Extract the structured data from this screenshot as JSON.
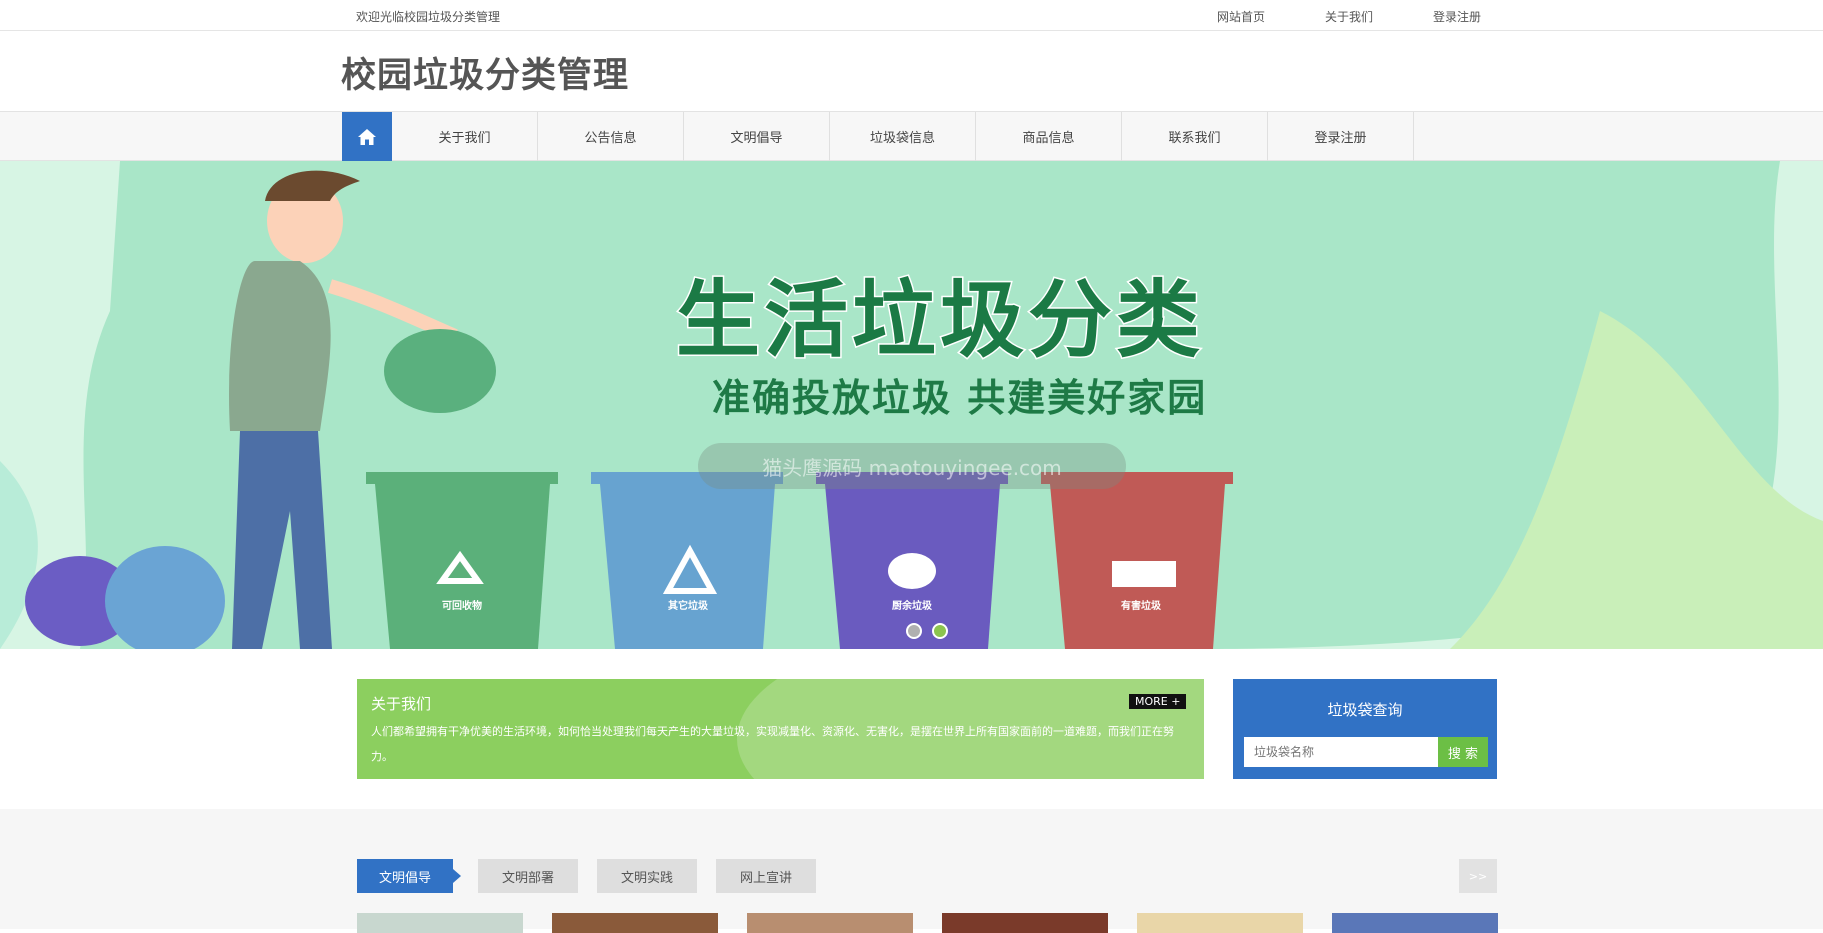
{
  "topbar": {
    "welcome": "欢迎光临校园垃圾分类管理",
    "links": [
      "网站首页",
      "关于我们",
      "登录注册"
    ]
  },
  "header": {
    "title": "校园垃圾分类管理"
  },
  "nav": {
    "home_icon": "home-icon",
    "items": [
      "关于我们",
      "公告信息",
      "文明倡导",
      "垃圾袋信息",
      "商品信息",
      "联系我们",
      "登录注册"
    ]
  },
  "banner": {
    "headline": "生活垃圾分类",
    "subline": "准确投放垃圾 共建美好家园",
    "watermark": "猫头鹰源码 maotouyingee.com",
    "bins": [
      "可回收物",
      "其它垃圾",
      "厨余垃圾",
      "有害垃圾"
    ],
    "bin_colors": [
      "#5bb07a",
      "#67a3d0",
      "#6a5bbf",
      "#c05a56"
    ],
    "slide_count": 2,
    "active_slide": 2
  },
  "about": {
    "title": "关于我们",
    "more": "MORE +",
    "text": "人们都希望拥有干净优美的生活环境，如何恰当处理我们每天产生的大量垃圾，实现减量化、资源化、无害化，是摆在世界上所有国家面前的一道难题，而我们正在努力。"
  },
  "search": {
    "title": "垃圾袋查询",
    "placeholder": "垃圾袋名称",
    "button": "搜 索"
  },
  "tabs": {
    "items": [
      "文明倡导",
      "文明部署",
      "文明实践",
      "网上宣讲"
    ],
    "active": 0,
    "next": ">>"
  },
  "colors": {
    "primary": "#3172c5",
    "green": "#8ccf5f",
    "search_button": "#6cbf45"
  }
}
